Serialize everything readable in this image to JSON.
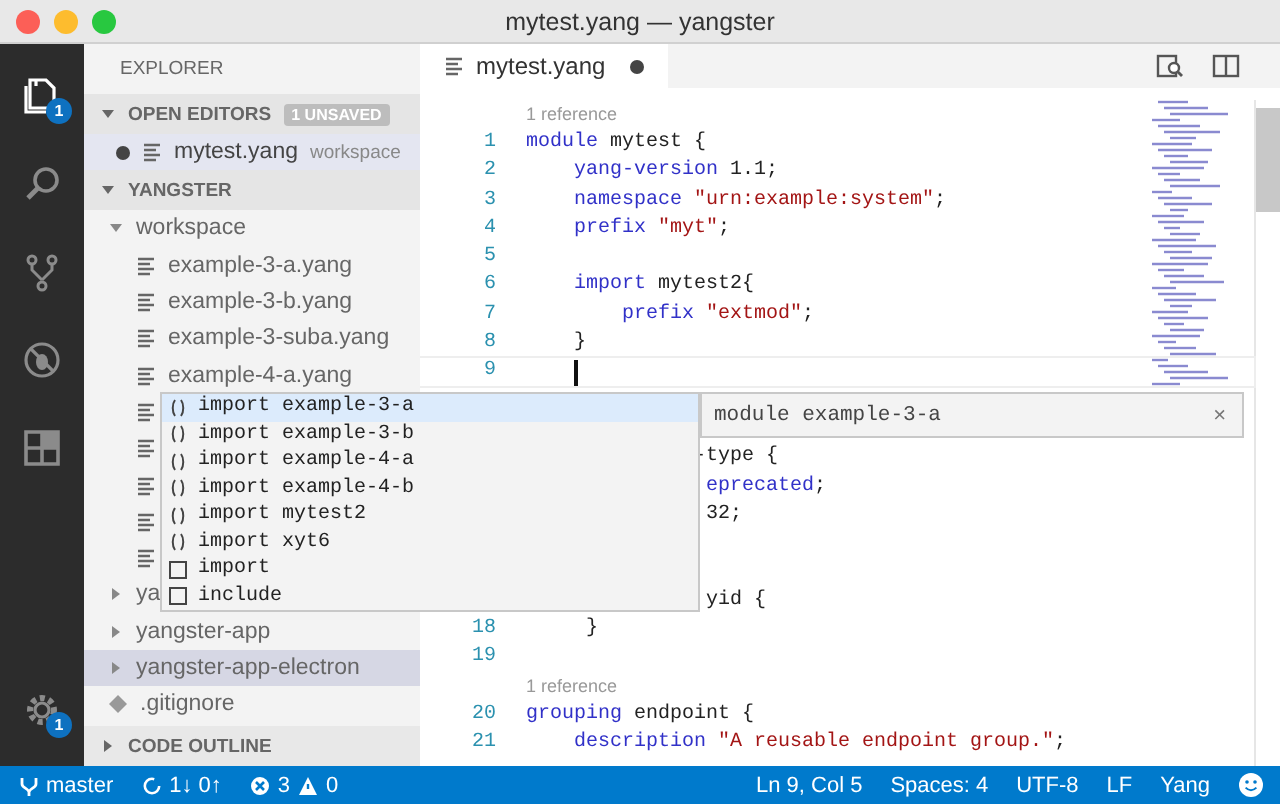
{
  "window": {
    "title": "mytest.yang — yangster"
  },
  "activity_bar": {
    "items": [
      {
        "kind": "files",
        "selected": true,
        "badge": "1"
      },
      {
        "kind": "search",
        "selected": false
      },
      {
        "kind": "scm",
        "selected": false
      },
      {
        "kind": "debug",
        "selected": false
      },
      {
        "kind": "extensions",
        "selected": false
      }
    ],
    "settings_badge": "1"
  },
  "sidebar": {
    "title": "EXPLORER",
    "open_editors": {
      "title": "OPEN EDITORS",
      "badge": "1 UNSAVED",
      "expanded": true,
      "items": [
        {
          "name": "mytest.yang",
          "description": "workspace",
          "dirty": true
        }
      ]
    },
    "folder": {
      "title": "YANGSTER",
      "expanded": true,
      "tree": [
        {
          "label": "workspace",
          "kind": "folder",
          "expanded": true,
          "selected": false,
          "children": [
            {
              "label": "example-3-a.yang",
              "kind": "file",
              "selected": false
            },
            {
              "label": "example-3-b.yang",
              "kind": "file",
              "selected": false
            },
            {
              "label": "example-3-suba.yang",
              "kind": "file",
              "selected": false
            },
            {
              "label": "example-4-a.yang",
              "kind": "file",
              "selected": false
            },
            {
              "kind": "file",
              "selected": false
            },
            {
              "kind": "file",
              "selected": false
            },
            {
              "kind": "file",
              "selected": false
            },
            {
              "kind": "file",
              "selected": false
            },
            {
              "kind": "file",
              "selected": false
            }
          ]
        },
        {
          "label": "ya",
          "kind": "folder",
          "expanded": false,
          "selected": false
        },
        {
          "label": "yangster-app",
          "kind": "folder",
          "expanded": false,
          "selected": false
        },
        {
          "label": "yangster-app-electron",
          "kind": "folder",
          "expanded": false,
          "selected": true
        },
        {
          "label": ".gitignore",
          "kind": "config",
          "selected": false
        }
      ]
    },
    "outline": {
      "title": "CODE OUTLINE",
      "expanded": false
    }
  },
  "editor": {
    "tabs": [
      {
        "name": "mytest.yang",
        "dirty": true,
        "selected": true
      }
    ],
    "lines": [
      {
        "kind": "lens",
        "text": "1 reference"
      },
      {
        "kind": "code",
        "number": "1",
        "tokens": [
          {
            "t": "module",
            "kind": "keyword"
          },
          {
            "t": " mytest {",
            "kind": "plain"
          }
        ]
      },
      {
        "kind": "code",
        "number": "2",
        "tokens": [
          {
            "t": "    yang-version",
            "kind": "keyword"
          },
          {
            "t": " 1.1;",
            "kind": "plain"
          }
        ]
      },
      {
        "kind": "code",
        "number": "3",
        "tokens": [
          {
            "t": "    namespace",
            "kind": "keyword"
          },
          {
            "t": " \"urn:example:system\"",
            "kind": "string"
          },
          {
            "t": ";",
            "kind": "plain"
          }
        ]
      },
      {
        "kind": "code",
        "number": "4",
        "tokens": [
          {
            "t": "    prefix",
            "kind": "keyword"
          },
          {
            "t": " \"myt\"",
            "kind": "string"
          },
          {
            "t": ";",
            "kind": "plain"
          }
        ]
      },
      {
        "kind": "code",
        "number": "5"
      },
      {
        "kind": "code",
        "number": "6",
        "tokens": [
          {
            "t": "    import",
            "kind": "keyword"
          },
          {
            "t": " mytest2{",
            "kind": "plain"
          }
        ]
      },
      {
        "kind": "code",
        "number": "7",
        "tokens": [
          {
            "t": "        prefix",
            "kind": "keyword"
          },
          {
            "t": " \"extmod\"",
            "kind": "string"
          },
          {
            "t": ";",
            "kind": "plain"
          }
        ]
      },
      {
        "kind": "code",
        "number": "8",
        "tokens": [
          {
            "t": "    }",
            "kind": "plain"
          }
        ]
      },
      {
        "kind": "code",
        "number": "9",
        "cursor": true
      },
      {
        "kind": "code"
      },
      {
        "kind": "code"
      },
      {
        "kind": "code",
        "tokens": [
          {
            "t": "              -type {",
            "kind": "plain"
          }
        ]
      },
      {
        "kind": "code",
        "tokens": [
          {
            "t": "               eprecated",
            "kind": "keyword"
          },
          {
            "t": ";",
            "kind": "plain"
          }
        ]
      },
      {
        "kind": "code",
        "tokens": [
          {
            "t": "               32;",
            "kind": "plain"
          }
        ]
      },
      {
        "kind": "code"
      },
      {
        "kind": "code"
      },
      {
        "kind": "code",
        "tokens": [
          {
            "t": "               yid {",
            "kind": "plain"
          }
        ]
      },
      {
        "kind": "code",
        "number": "18",
        "tokens": [
          {
            "t": "     }",
            "kind": "plain"
          }
        ]
      },
      {
        "kind": "code",
        "number": "19"
      },
      {
        "kind": "lens",
        "text": "1 reference"
      },
      {
        "kind": "code",
        "number": "20",
        "tokens": [
          {
            "t": "grouping",
            "kind": "keyword"
          },
          {
            "t": " endpoint {",
            "kind": "plain"
          }
        ]
      },
      {
        "kind": "code",
        "number": "21",
        "tokens": [
          {
            "t": "    description",
            "kind": "keyword"
          },
          {
            "t": " \"A reusable endpoint group.\"",
            "kind": "string"
          },
          {
            "t": ";",
            "kind": "plain"
          }
        ]
      }
    ]
  },
  "suggest": {
    "items": [
      {
        "kind": "module",
        "label": "import example-3-a",
        "selected": true
      },
      {
        "kind": "module",
        "label": "import example-3-b",
        "selected": false
      },
      {
        "kind": "module",
        "label": "import example-4-a",
        "selected": false
      },
      {
        "kind": "module",
        "label": "import example-4-b",
        "selected": false
      },
      {
        "kind": "module",
        "label": "import mytest2",
        "selected": false
      },
      {
        "kind": "module",
        "label": "import xyt6",
        "selected": false
      },
      {
        "kind": "snippet",
        "label": "import",
        "selected": false
      },
      {
        "kind": "snippet",
        "label": "include",
        "selected": false
      }
    ],
    "detail": {
      "title": "module example-3-a",
      "close": "×"
    }
  },
  "status_bar": {
    "branch": "master",
    "sync": "1↓ 0↑",
    "errors": "3",
    "warnings": "0",
    "right": [
      "Ln 9, Col 5",
      "Spaces: 4",
      "UTF-8",
      "LF",
      "Yang"
    ]
  }
}
